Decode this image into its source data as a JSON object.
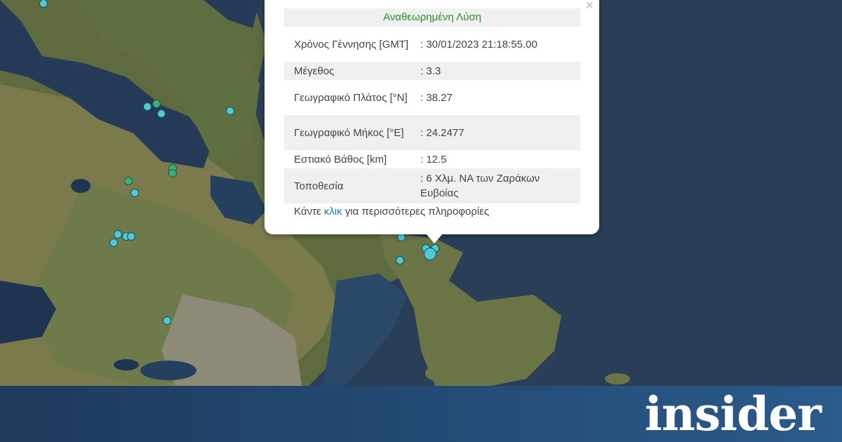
{
  "popup": {
    "title": "Αναθεωρημένη Λύση",
    "close_glyph": "×",
    "rows": [
      {
        "label": "Χρόνος Γέννησης [GMT]",
        "value": ": 30/01/2023 21:18:55.00"
      },
      {
        "label": "Μέγεθος",
        "value": ": 3.3"
      },
      {
        "label": "Γεωγραφικό Πλάτος [°N]",
        "value": ": 38.27"
      },
      {
        "label": "Γεωγραφικό Μήκος [°E]",
        "value": ": 24.2477"
      },
      {
        "label": "Εστιακό Βάθος [km]",
        "value": ": 12.5"
      },
      {
        "label": "Τοποθεσία",
        "value": ": 6 Χλμ. ΝΑ των Ζαράκων Ευβοίας"
      }
    ],
    "footer_prefix": "Κάντε ",
    "footer_link": "κλικ",
    "footer_suffix": " για περισσότερες πληροφορίες"
  },
  "brand": {
    "logo_text": "insider"
  },
  "colors": {
    "quake_blue": "#4ec9d6",
    "quake_green": "#3fae78",
    "popup_title": "#2e8b2e",
    "link": "#1f78b4"
  }
}
